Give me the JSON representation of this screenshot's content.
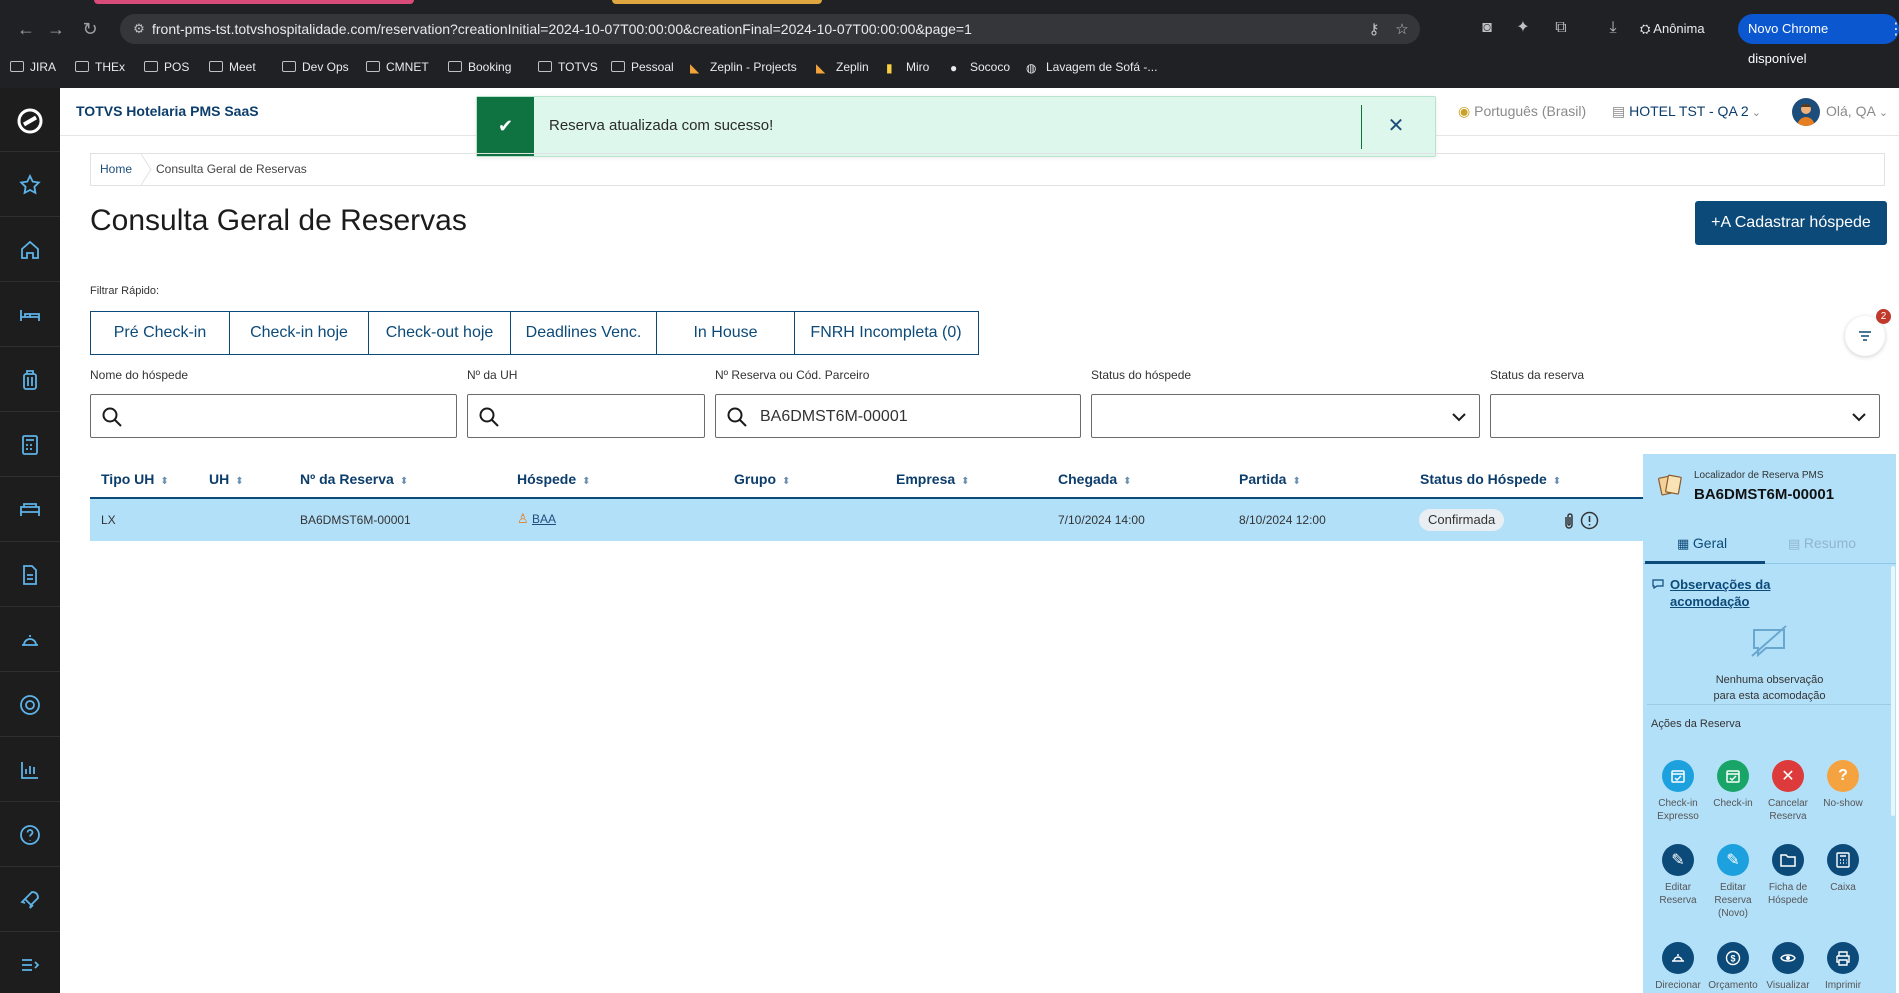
{
  "browser": {
    "url": "front-pms-tst.totvshospitalidade.com/reservation?creationInitial=2024-10-07T00:00:00&creationFinal=2024-10-07T00:00:00&page=1",
    "incognito_label": "Anônima",
    "update_pill": "Novo Chrome disponível",
    "bookmarks": [
      "JIRA",
      "THEx",
      "POS",
      "Meet",
      "Dev Ops",
      "CMNET",
      "Booking",
      "TOTVS",
      "Pessoal",
      "Zeplin - Projects",
      "Zeplin",
      "Miro",
      "Sococo",
      "Lavagem de Sofá -..."
    ]
  },
  "header": {
    "app_title": "TOTVS Hotelaria PMS SaaS",
    "language": "Português (Brasil)",
    "hotel": "HOTEL TST - QA 2",
    "greeting": "Olá, QA"
  },
  "toast": {
    "message": "Reserva atualizada com sucesso!"
  },
  "breadcrumb": {
    "home": "Home",
    "current": "Consulta Geral de Reservas"
  },
  "page": {
    "title": "Consulta Geral de Reservas",
    "primary_button": "+A Cadastrar hóspede",
    "quick_filter_label": "Filtrar Rápido:",
    "quick_filters": [
      "Pré Check-in",
      "Check-in hoje",
      "Check-out hoje",
      "Deadlines Venc.",
      "In House",
      "FNRH Incompleta (0)"
    ],
    "filter_badge_count": "2"
  },
  "filters": {
    "guest_name_label": "Nome do hóspede",
    "guest_name_value": "",
    "room_label": "Nº da UH",
    "room_value": "",
    "reservation_label": "Nº Reserva ou Cód. Parceiro",
    "reservation_value": "BA6DMST6M-00001",
    "guest_status_label": "Status do hóspede",
    "reservation_status_label": "Status da reserva"
  },
  "table": {
    "columns": [
      "Tipo UH",
      "UH",
      "Nº da Reserva",
      "Hóspede",
      "Grupo",
      "Empresa",
      "Chegada",
      "Partida",
      "Status do Hóspede"
    ],
    "rows": [
      {
        "room_type": "LX",
        "room": "",
        "reservation": "BA6DMST6M-00001",
        "guest": "BAA",
        "group": "",
        "company": "",
        "arrival": "7/10/2024 14:00",
        "departure": "8/10/2024 12:00",
        "status": "Confirmada"
      }
    ]
  },
  "panel": {
    "caption": "Localizador de Reserva PMS",
    "code": "BA6DMST6M-00001",
    "tab_general": "Geral",
    "tab_summary": "Resumo",
    "obs_title": "Observações da acomodação",
    "obs_empty_line1": "Nenhuma observação",
    "obs_empty_line2": "para esta acomodação",
    "actions_title": "Ações da Reserva",
    "actions": [
      {
        "label": "Check-in Expresso",
        "color": "#1da1de",
        "icon": "calendar-check-icon"
      },
      {
        "label": "Check-in",
        "color": "#18a567",
        "icon": "calendar-check-icon"
      },
      {
        "label": "Cancelar Reserva",
        "color": "#dd3b3b",
        "icon": "close-icon"
      },
      {
        "label": "No-show",
        "color": "#f5a340",
        "icon": "question-icon"
      },
      {
        "label": "Editar Reserva",
        "color": "#0c4a79",
        "icon": "pencil-icon"
      },
      {
        "label": "Editar Reserva (Novo)",
        "color": "#1da1de",
        "icon": "pencil-icon"
      },
      {
        "label": "Ficha de Hóspede",
        "color": "#0c4a79",
        "icon": "folder-icon"
      },
      {
        "label": "Caixa",
        "color": "#0c4a79",
        "icon": "calculator-icon"
      },
      {
        "label": "Direcionar",
        "color": "#0c4a79",
        "icon": "hand-icon"
      },
      {
        "label": "Orçamento",
        "color": "#0c4a79",
        "icon": "dollar-icon"
      },
      {
        "label": "Visualizar",
        "color": "#0c4a79",
        "icon": "eye-icon"
      },
      {
        "label": "Imprimir",
        "color": "#0c4a79",
        "icon": "printer-icon"
      }
    ]
  },
  "colors": {
    "brand_dark": "#0c4a79",
    "row_highlight": "#b3e0f9",
    "toast_green": "#0e7340"
  }
}
